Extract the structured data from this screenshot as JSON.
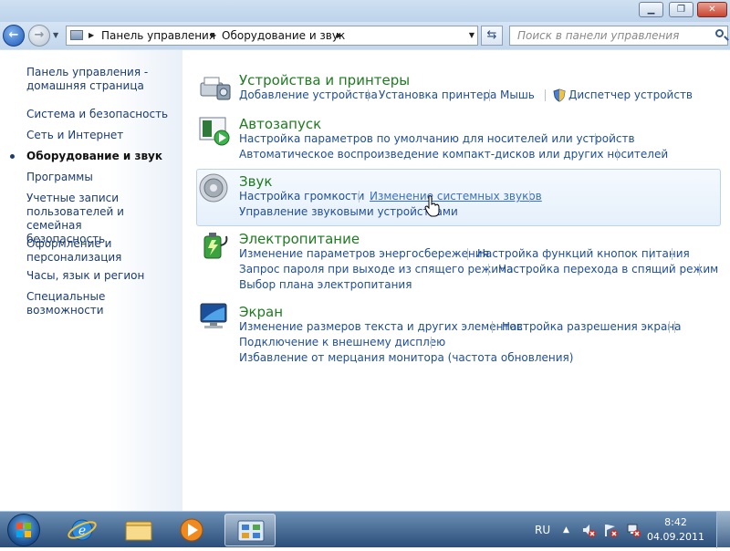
{
  "breadcrumb": {
    "items": [
      "Панель управления",
      "Оборудование и звук"
    ]
  },
  "search": {
    "placeholder": "Поиск в панели управления"
  },
  "sidebar": {
    "items": [
      {
        "label_l1": "Панель управления -",
        "label_l2": "домашняя страница"
      },
      {
        "label": "Система и безопасность"
      },
      {
        "label": "Сеть и Интернет"
      },
      {
        "label": "Оборудование и звук",
        "active": true
      },
      {
        "label": "Программы"
      },
      {
        "label_l1": "Учетные записи",
        "label_l2": "пользователей и семейная",
        "label_l3": "безопасность"
      },
      {
        "label_l1": "Оформление и",
        "label_l2": "персонализация"
      },
      {
        "label": "Часы, язык и регион"
      },
      {
        "label": "Специальные возможности"
      }
    ]
  },
  "categories": {
    "devices": {
      "title": "Устройства и принтеры",
      "links": [
        "Добавление устройства",
        "Установка принтера",
        "Мышь",
        "Диспетчер устройств"
      ]
    },
    "autoplay": {
      "title": "Автозапуск",
      "links": [
        "Настройка параметров по умолчанию для носителей или устройств",
        "Автоматическое воспроизведение компакт-дисков или других носителей"
      ]
    },
    "sound": {
      "title": "Звук",
      "links": [
        "Настройка громкости",
        "Изменение системных звуков",
        "Управление звуковыми устройствами"
      ]
    },
    "power": {
      "title": "Электропитание",
      "links": [
        "Изменение параметров энергосбережения",
        "Настройка функций кнопок питания",
        "Запрос пароля при выходе из спящего режима",
        "Настройка перехода в спящий режим",
        "Выбор плана электропитания"
      ]
    },
    "display": {
      "title": "Экран",
      "links": [
        "Изменение размеров текста и других элементов",
        "Настройка разрешения экрана",
        "Подключение к внешнему дисплею",
        "Избавление от мерцания монитора (частота обновления)"
      ]
    }
  },
  "taskbar": {
    "language": "RU",
    "time": "8:42",
    "date": "04.09.2011"
  },
  "colors": {
    "title_green": "#1e7b20",
    "link_blue": "#1f4e97",
    "nav_text": "#1b3c73"
  }
}
